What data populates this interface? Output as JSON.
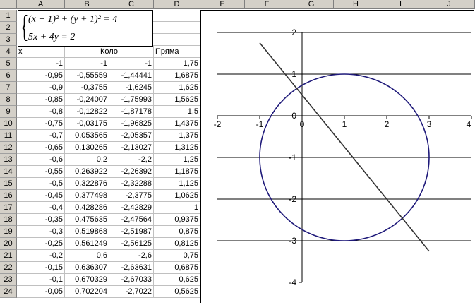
{
  "columns": [
    "A",
    "B",
    "C",
    "D",
    "E",
    "F",
    "G",
    "H",
    "I",
    "J"
  ],
  "rows": [
    {
      "num": "1"
    },
    {
      "num": "2"
    },
    {
      "num": "3"
    },
    {
      "num": "4",
      "a": "x",
      "bc": "Коло",
      "d": "Пряма"
    },
    {
      "num": "5",
      "a": "-1",
      "b": "-1",
      "c": "-1",
      "d": "1,75"
    },
    {
      "num": "6",
      "a": "-0,95",
      "b": "-0,55559",
      "c": "-1,44441",
      "d": "1,6875"
    },
    {
      "num": "7",
      "a": "-0,9",
      "b": "-0,3755",
      "c": "-1,6245",
      "d": "1,625"
    },
    {
      "num": "8",
      "a": "-0,85",
      "b": "-0,24007",
      "c": "-1,75993",
      "d": "1,5625"
    },
    {
      "num": "9",
      "a": "-0,8",
      "b": "-0,12822",
      "c": "-1,87178",
      "d": "1,5"
    },
    {
      "num": "10",
      "a": "-0,75",
      "b": "-0,03175",
      "c": "-1,96825",
      "d": "1,4375"
    },
    {
      "num": "11",
      "a": "-0,7",
      "b": "0,053565",
      "c": "-2,05357",
      "d": "1,375"
    },
    {
      "num": "12",
      "a": "-0,65",
      "b": "0,130265",
      "c": "-2,13027",
      "d": "1,3125"
    },
    {
      "num": "13",
      "a": "-0,6",
      "b": "0,2",
      "c": "-2,2",
      "d": "1,25"
    },
    {
      "num": "14",
      "a": "-0,55",
      "b": "0,263922",
      "c": "-2,26392",
      "d": "1,1875"
    },
    {
      "num": "15",
      "a": "-0,5",
      "b": "0,322876",
      "c": "-2,32288",
      "d": "1,125"
    },
    {
      "num": "16",
      "a": "-0,45",
      "b": "0,377498",
      "c": "-2,3775",
      "d": "1,0625"
    },
    {
      "num": "17",
      "a": "-0,4",
      "b": "0,428286",
      "c": "-2,42829",
      "d": "1"
    },
    {
      "num": "18",
      "a": "-0,35",
      "b": "0,475635",
      "c": "-2,47564",
      "d": "0,9375"
    },
    {
      "num": "19",
      "a": "-0,3",
      "b": "0,519868",
      "c": "-2,51987",
      "d": "0,875"
    },
    {
      "num": "20",
      "a": "-0,25",
      "b": "0,561249",
      "c": "-2,56125",
      "d": "0,8125"
    },
    {
      "num": "21",
      "a": "-0,2",
      "b": "0,6",
      "c": "-2,6",
      "d": "0,75"
    },
    {
      "num": "22",
      "a": "-0,15",
      "b": "0,636307",
      "c": "-2,63631",
      "d": "0,6875"
    },
    {
      "num": "23",
      "a": "-0,1",
      "b": "0,670329",
      "c": "-2,67033",
      "d": "0,625"
    },
    {
      "num": "24",
      "a": "-0,05",
      "b": "0,702204",
      "c": "-2,7022",
      "d": "0,5625"
    }
  ],
  "equations": {
    "eq1": "(x − 1)² + (y + 1)² = 4",
    "eq2": "5x + 4y = 2"
  },
  "chart_data": {
    "type": "scatter",
    "xlim": [
      -2,
      4
    ],
    "ylim": [
      -4,
      2
    ],
    "x_ticks": [
      "-2",
      "-1",
      "0",
      "1",
      "2",
      "3",
      "4"
    ],
    "y_ticks": [
      "2",
      "1",
      "0",
      "-1",
      "-2",
      "-3",
      "-4"
    ],
    "grid": "horizontal major gridlines",
    "legend": "none",
    "series": [
      {
        "kind": "circle",
        "center": [
          1,
          -1
        ],
        "radius": 2,
        "color": "#1f1a7a"
      },
      {
        "kind": "line",
        "x": [
          -1,
          3
        ],
        "y": [
          1.75,
          -3.25
        ],
        "color": "#333333"
      }
    ]
  }
}
